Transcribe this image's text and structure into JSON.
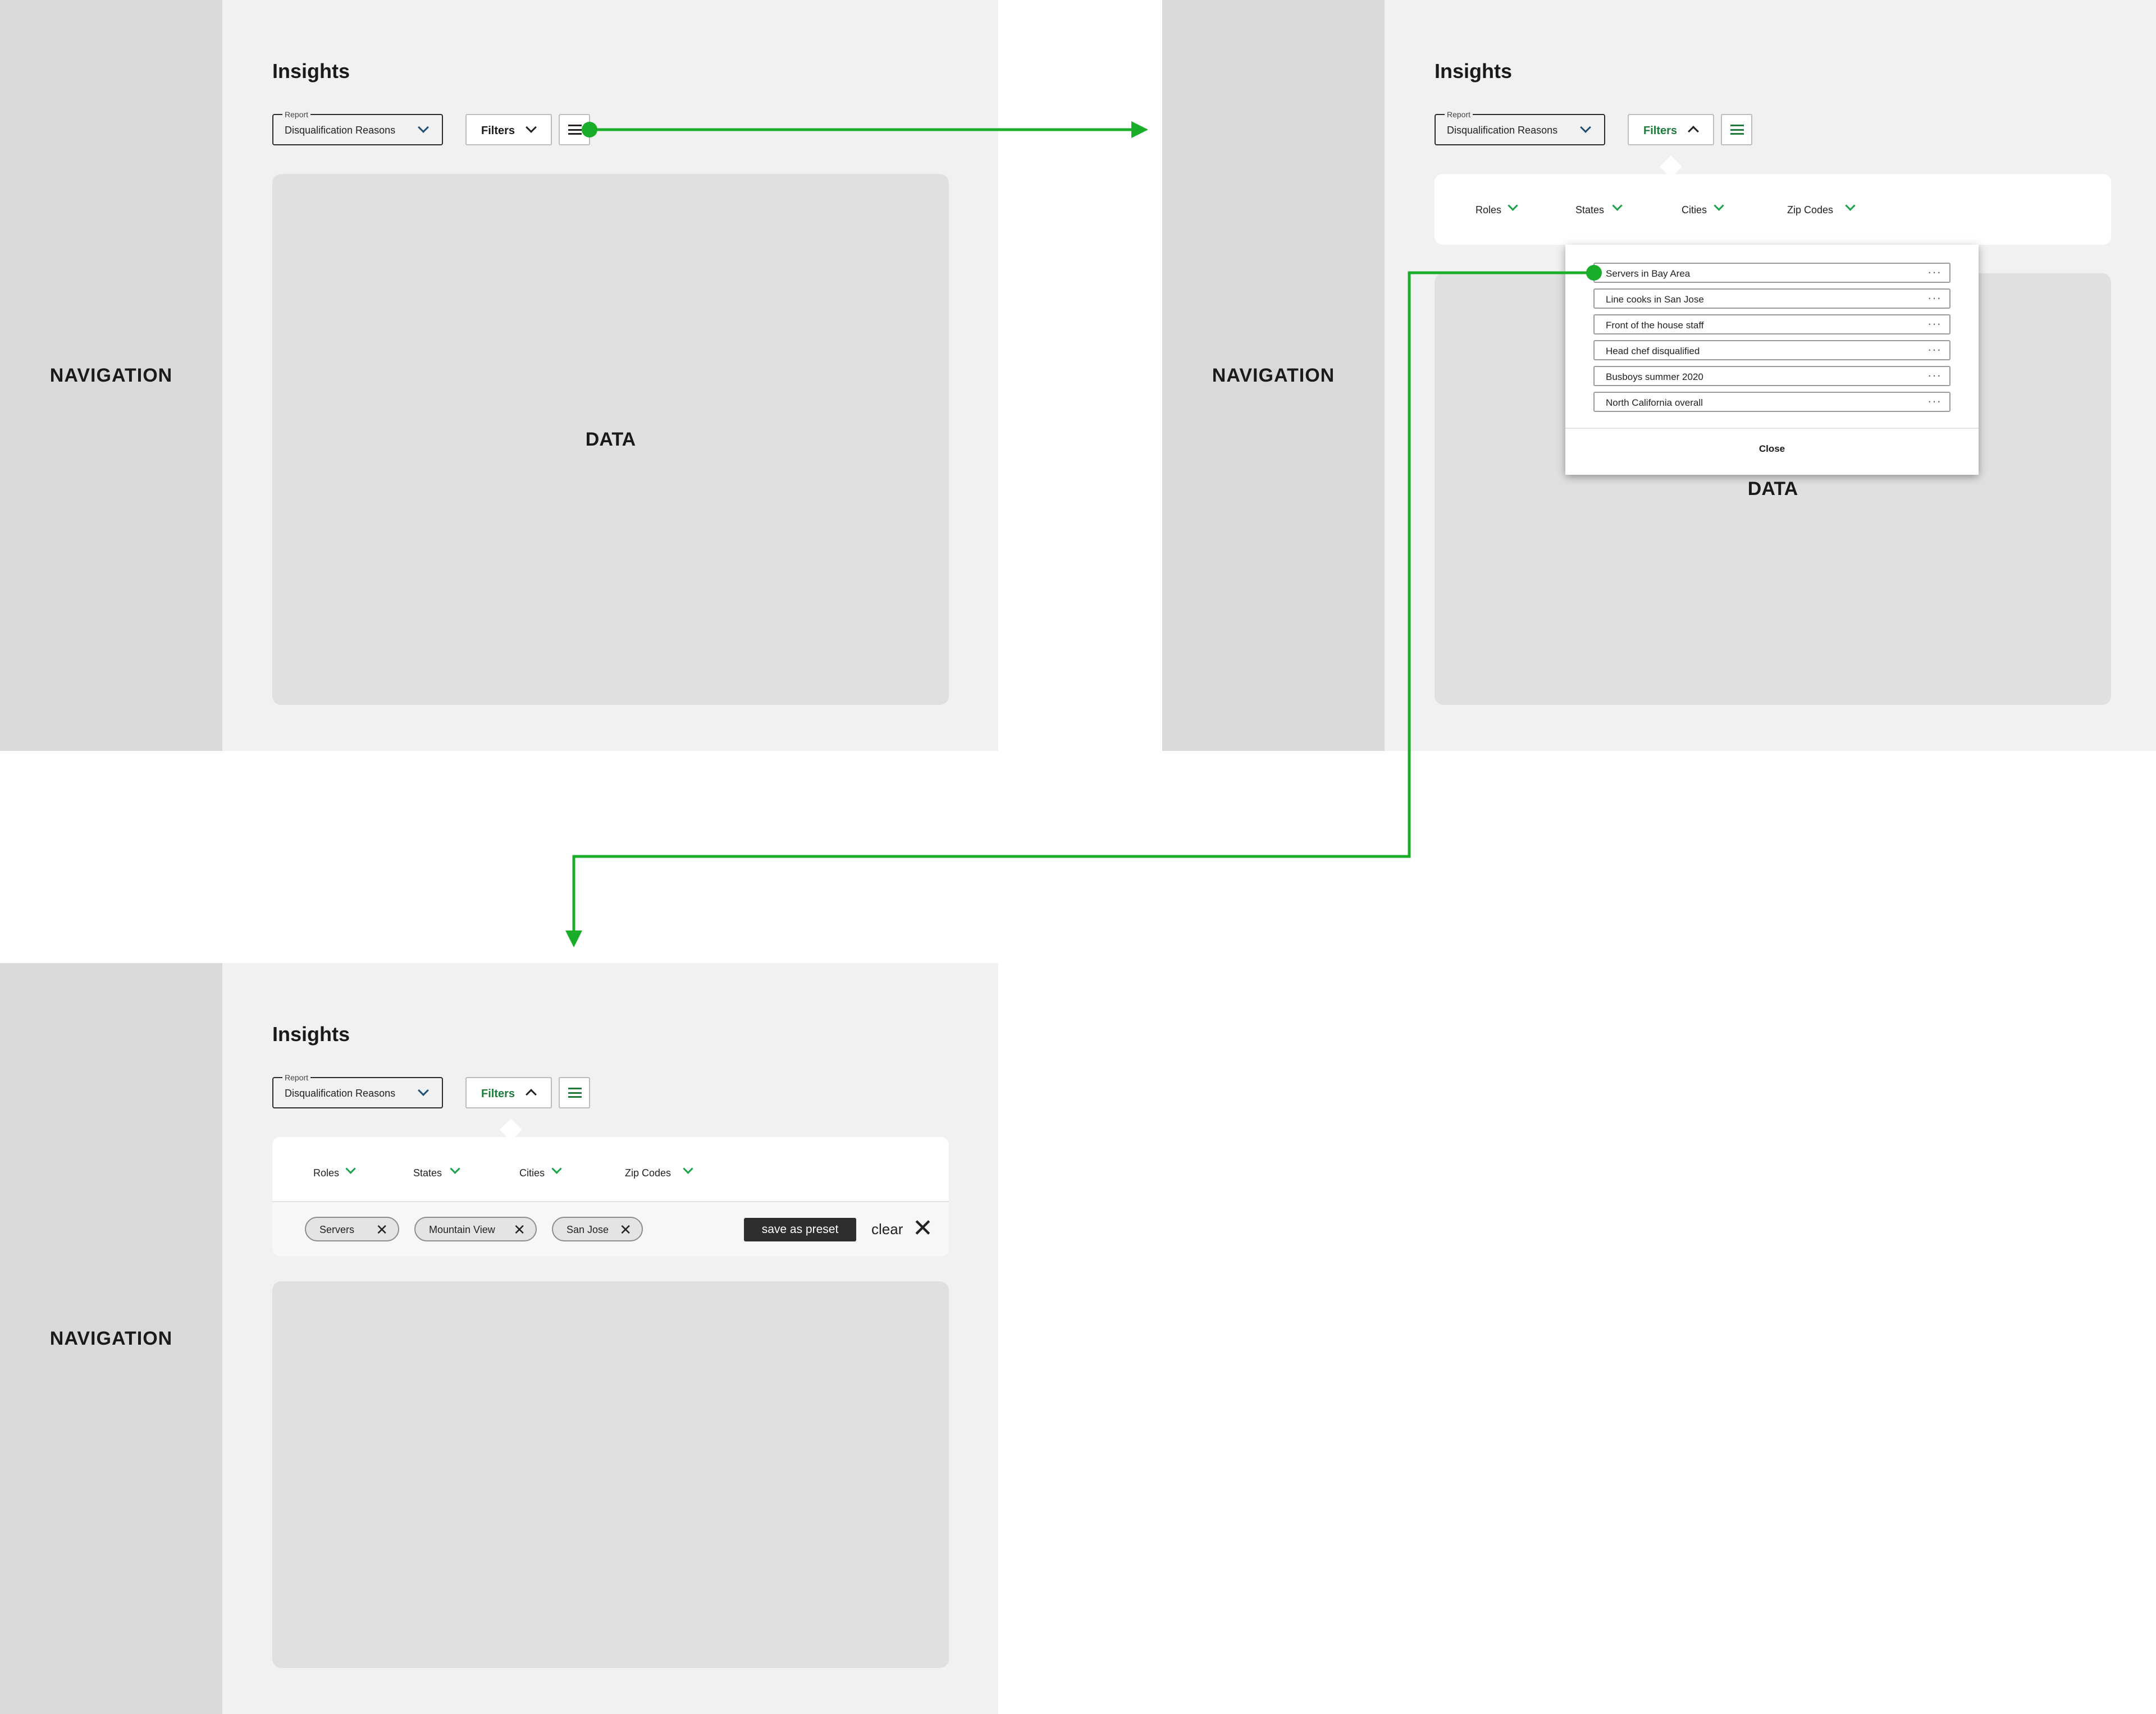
{
  "frames": [
    {
      "navigation": "NAVIGATION",
      "title": "Insights",
      "report_label": "Report",
      "report_value": "Disqualification Reasons",
      "filters_label": "Filters",
      "data_label": "DATA"
    },
    {
      "navigation": "NAVIGATION",
      "title": "Insights",
      "report_label": "Report",
      "report_value": "Disqualification Reasons",
      "filters_label": "Filters",
      "data_label": "DATA",
      "categories": [
        "Roles",
        "States",
        "Cities",
        "Zip Codes"
      ],
      "presets": [
        "Servers in Bay Area",
        "Line cooks in San Jose",
        "Front of the house staff",
        "Head chef disqualified",
        "Busboys summer 2020",
        "North California overall"
      ],
      "more_glyph": "···",
      "close_label": "Close"
    },
    {
      "navigation": "NAVIGATION",
      "title": "Insights",
      "report_label": "Report",
      "report_value": "Disqualification Reasons",
      "filters_label": "Filters",
      "categories": [
        "Roles",
        "States",
        "Cities",
        "Zip Codes"
      ],
      "chips": [
        "Servers",
        "Mountain View",
        "San Jose"
      ],
      "chip_remove_glyph": "✕",
      "save_preset_label": "save as preset",
      "clear_label": "clear",
      "clear_glyph": "✕"
    }
  ],
  "colors": {
    "flow_arrow": "#1aad2a",
    "accent_green": "#1e7a3b",
    "navigation_bg": "#d9d9d9",
    "canvas_bg": "#f1f1f1",
    "data_bg": "#e0e0e0"
  }
}
